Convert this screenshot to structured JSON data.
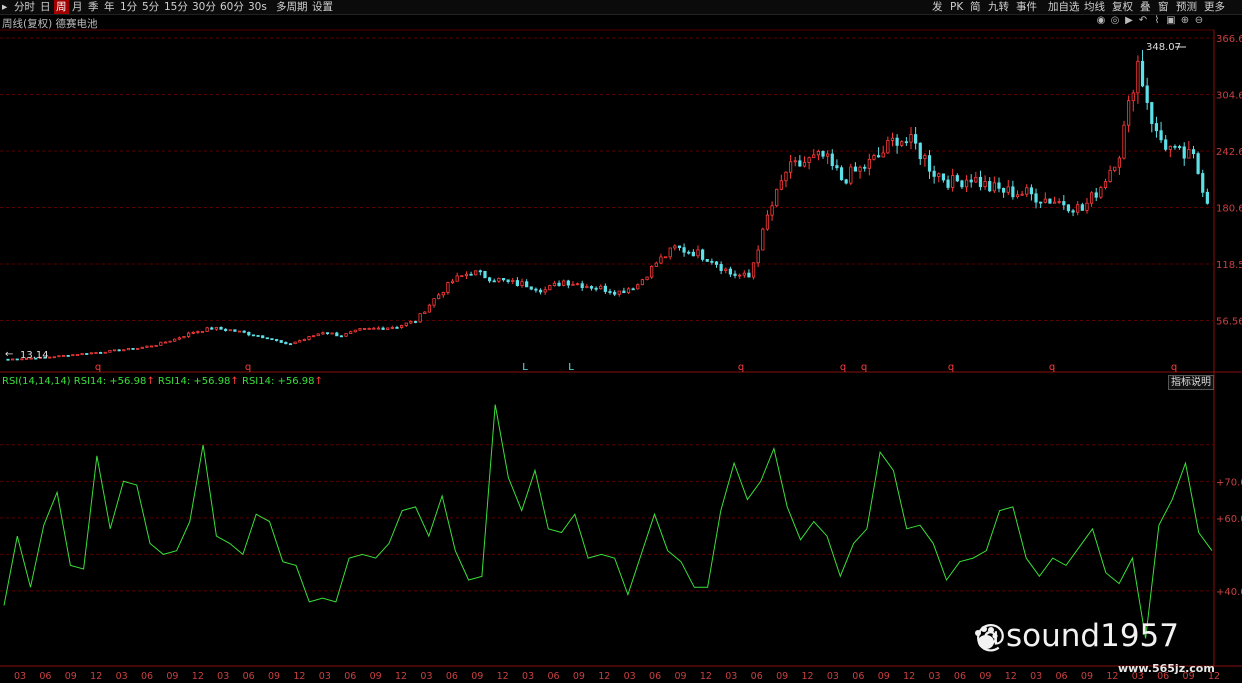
{
  "toolbar": {
    "left_items": [
      "分时",
      "日",
      "周",
      "月",
      "季",
      "年",
      "1分",
      "5分",
      "15分",
      "30分",
      "60分",
      "30s",
      "多周期",
      "设置"
    ],
    "selected": "周",
    "right_items": [
      "发",
      "PK",
      "简",
      "九转",
      "事件",
      "加自选",
      "均线",
      "复权",
      "叠",
      "窗",
      "预测",
      "更多"
    ]
  },
  "chart_title": "周线(复权) 德赛电池",
  "price_axis": {
    "ticks": [
      "366.6",
      "304.6",
      "242.6",
      "180.6",
      "118.5",
      "56.56"
    ]
  },
  "annotations": {
    "low_label": "13.14",
    "high_label": "348.07"
  },
  "event_markers": [
    "q",
    "q",
    "L",
    "L",
    "q",
    "q",
    "q",
    "q",
    "q",
    "q"
  ],
  "rsi_legend": {
    "name": "RSI(14,14,14)",
    "v1": "RSI14: +56.98",
    "v2": "RSI14: +56.98",
    "v3": "RSI14: +56.98",
    "arrow": "↑"
  },
  "indicator_button": "指标说明",
  "rsi_axis": {
    "ticks": [
      "+70.0",
      "+60.0",
      "+40.0"
    ]
  },
  "x_axis_ticks": [
    "03",
    "06",
    "09",
    "12",
    "03",
    "06",
    "09",
    "12",
    "03",
    "06",
    "09",
    "12",
    "03",
    "06",
    "09",
    "12",
    "03",
    "06",
    "09",
    "12",
    "03",
    "06",
    "09",
    "12",
    "03",
    "06",
    "09",
    "12",
    "03",
    "06",
    "09",
    "12",
    "03",
    "06",
    "09",
    "12",
    "03",
    "06",
    "09",
    "12",
    "03",
    "06",
    "09",
    "12",
    "03",
    "06",
    "09",
    "12"
  ],
  "watermark": {
    "text": "@sound1957",
    "site": "www.565jz.com"
  },
  "colors": {
    "up": "#ff3b3b",
    "down": "#5ee0e8",
    "rsi": "#3adf3a",
    "grid": "#8a1010",
    "axis_text": "#c84040"
  },
  "chart_data": [
    {
      "type": "candlestick",
      "title": "周线(复权) 德赛电池",
      "ylim": [
        0,
        366.6
      ],
      "close": [
        14,
        15,
        16,
        18,
        20,
        22,
        24,
        26,
        30,
        36,
        44,
        48,
        46,
        42,
        38,
        30,
        36,
        44,
        40,
        46,
        48,
        50,
        56,
        80,
        100,
        110,
        104,
        98,
        96,
        90,
        100,
        96,
        92,
        88,
        96,
        120,
        136,
        132,
        124,
        108,
        104,
        170,
        220,
        230,
        236,
        212,
        222,
        236,
        258,
        248,
        220,
        208,
        214,
        202,
        198,
        196,
        190,
        186,
        178,
        204,
        242,
        340,
        260,
        240,
        234,
        176
      ],
      "markers": [
        "q",
        "q",
        "L",
        "L",
        "q",
        "q",
        "q",
        "q",
        "q",
        "q"
      ]
    },
    {
      "type": "line",
      "title": "RSI(14,14,14)",
      "series": [
        {
          "name": "RSI14",
          "values": [
            36,
            52,
            44,
            58,
            64,
            50,
            46,
            74,
            60,
            70,
            66,
            56,
            50,
            48,
            62,
            80,
            52,
            56,
            50,
            58,
            62,
            48,
            44,
            40,
            38,
            34,
            52,
            50,
            46,
            56,
            62,
            60,
            58,
            66,
            48,
            46,
            44,
            88,
            74,
            62,
            70,
            60,
            56,
            58,
            52,
            50,
            46,
            42,
            50,
            58,
            54,
            48,
            38,
            44,
            62,
            72,
            68,
            70,
            76,
            66,
            54,
            56,
            58,
            44,
            50,
            60,
            78,
            70,
            60,
            58,
            50,
            46,
            48,
            46,
            54,
            62,
            60,
            52,
            44,
            46,
            50,
            52,
            54,
            48,
            42,
            46,
            30,
            58,
            62,
            78,
            56,
            48
          ]
        }
      ],
      "ylim": [
        20,
        95
      ],
      "last_value": 56.98
    }
  ]
}
